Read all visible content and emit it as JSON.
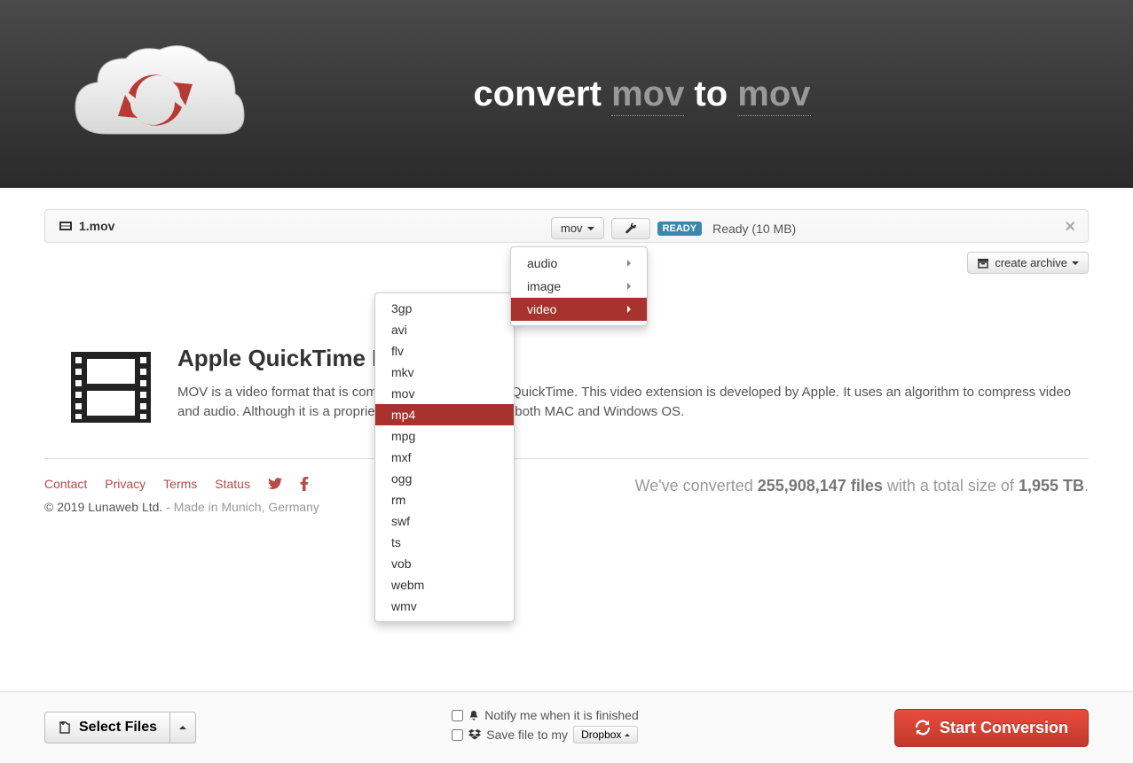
{
  "header": {
    "title_prefix": "convert ",
    "fmt_from": "mov",
    "title_mid": " to ",
    "fmt_to": "mov"
  },
  "file": {
    "name": "1.mov",
    "output_format": "mov",
    "ready_badge": "READY",
    "ready_text": "Ready (10 MB)"
  },
  "archive_btn": "create archive",
  "dropdown_categories": [
    {
      "label": "audio",
      "active": false
    },
    {
      "label": "image",
      "active": false
    },
    {
      "label": "video",
      "active": true
    }
  ],
  "dropdown_formats": [
    "3gp",
    "avi",
    "flv",
    "mkv",
    "mov",
    "mp4",
    "mpg",
    "mxf",
    "ogg",
    "rm",
    "swf",
    "ts",
    "vob",
    "webm",
    "wmv"
  ],
  "dropdown_format_active": "mp4",
  "format_info": {
    "title": "Apple QuickTime Movie",
    "desc": "MOV is a video format that is commonly associated with QuickTime. This video extension is developed by Apple. It uses an algorithm to compress video and audio. Although it is a proprietary of Apple, it runs on both MAC and Windows OS."
  },
  "footer": {
    "links": [
      "Contact",
      "Privacy",
      "Terms",
      "Status"
    ],
    "copyright": "© 2019 Lunaweb Ltd.",
    "copyright_muted": " - Made in Munich, Germany",
    "stats_prefix": "We've converted ",
    "stats_files": "255,908,147 files",
    "stats_mid": " with a total size of ",
    "stats_size": "1,955 TB",
    "stats_suffix": "."
  },
  "bottom": {
    "select_files": "Select Files",
    "notify_label": "Notify me when it is finished",
    "save_label": "Save file to my",
    "dropbox": "Dropbox",
    "start": "Start Conversion"
  }
}
